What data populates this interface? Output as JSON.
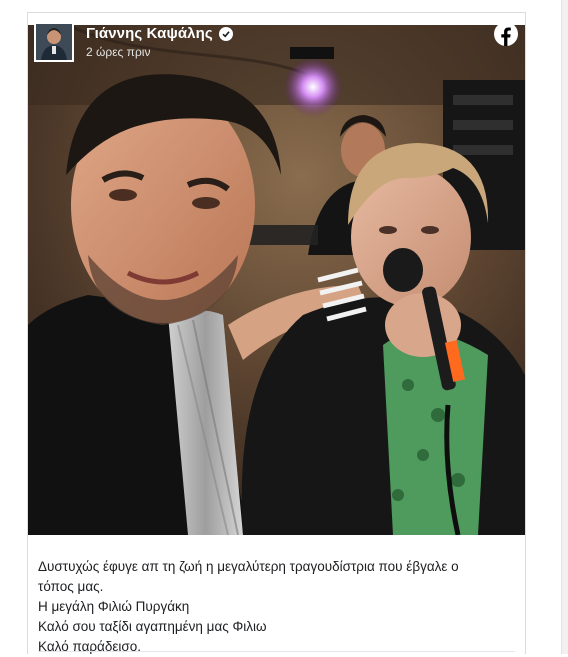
{
  "post": {
    "author": "Γιάννης Καψάλης",
    "verified": true,
    "time": "2 ώρες πριν",
    "platform_icon": "facebook-icon",
    "caption_lines": [
      "Δυστυχώς έφυγε απ τη ζωή η μεγαλύτερη τραγουδίστρια που έβγαλε ο",
      "τόπος μας.",
      "Η μεγάλη Φιλιώ Πυργάκη",
      "Καλό σου ταξίδι αγαπημένη μας Φιλιω",
      "Καλό παράδεισο."
    ]
  },
  "colors": {
    "facebook_blue": "#1877f2",
    "stage_light": "#b04bd8",
    "mic_accent": "#ff6a1f"
  }
}
